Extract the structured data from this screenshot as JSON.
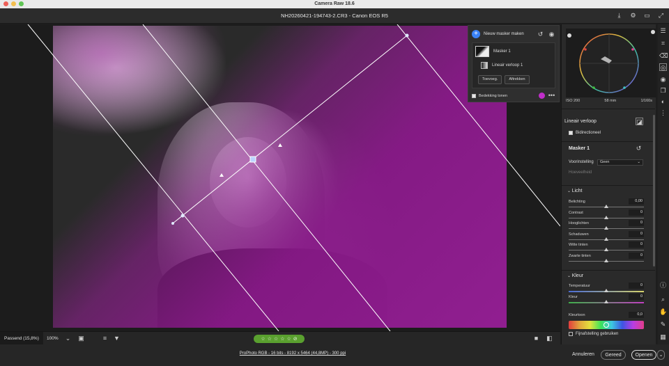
{
  "window": {
    "app_title": "Camera Raw 18.6",
    "document_title": "NH20260421-194743-2.CR3  -  Canon EOS R5"
  },
  "mask_panel": {
    "create_label": "Nieuw masker maken",
    "mask_name": "Masker 1",
    "component_name": "Lineair verloop 1",
    "add_label": "Toevoeg.",
    "subtract_label": "Aftrekken",
    "overlay_label": "Bedekking tonen",
    "overlay_color": "#c02ec9"
  },
  "histogram": {
    "iso": "ISO 200",
    "focal": "58 mm",
    "shutter": "1/160s"
  },
  "gradient_section": {
    "title": "Lineair verloop",
    "bidirectional_label": "Bidirectioneel"
  },
  "mask_section": {
    "title": "Masker 1",
    "preset_label": "Voorinstelling",
    "preset_value": "Geen",
    "amount_label": "Hoeveelheid"
  },
  "light_section": {
    "title": "Licht",
    "sliders": [
      {
        "label": "Belichting",
        "value": "0,00"
      },
      {
        "label": "Contrast",
        "value": "0"
      },
      {
        "label": "Hooglichten",
        "value": "0"
      },
      {
        "label": "Schaduwen",
        "value": "0"
      },
      {
        "label": "Witte tinten",
        "value": "0"
      },
      {
        "label": "Zwarte tinten",
        "value": "0"
      }
    ]
  },
  "color_section": {
    "title": "Kleur",
    "temp_label": "Temperatuur",
    "temp_value": "0",
    "tint_label": "Kleur",
    "tint_value": "0",
    "hue_label": "Kleurtoon",
    "hue_value": "0,0",
    "fine_label": "Fijnafstelling gebruiken"
  },
  "bottom": {
    "zoom_fit": "Passend (15,8%)",
    "zoom_100": "100%",
    "stars": [
      "☆",
      "☆",
      "☆",
      "☆",
      "☆"
    ],
    "workflow_link": "ProPhoto RGB - 16 bits - 8192 x 5464 (44,8MP) - 300 ppi",
    "cancel": "Annuleren",
    "done": "Gereed",
    "open": "Openen"
  }
}
